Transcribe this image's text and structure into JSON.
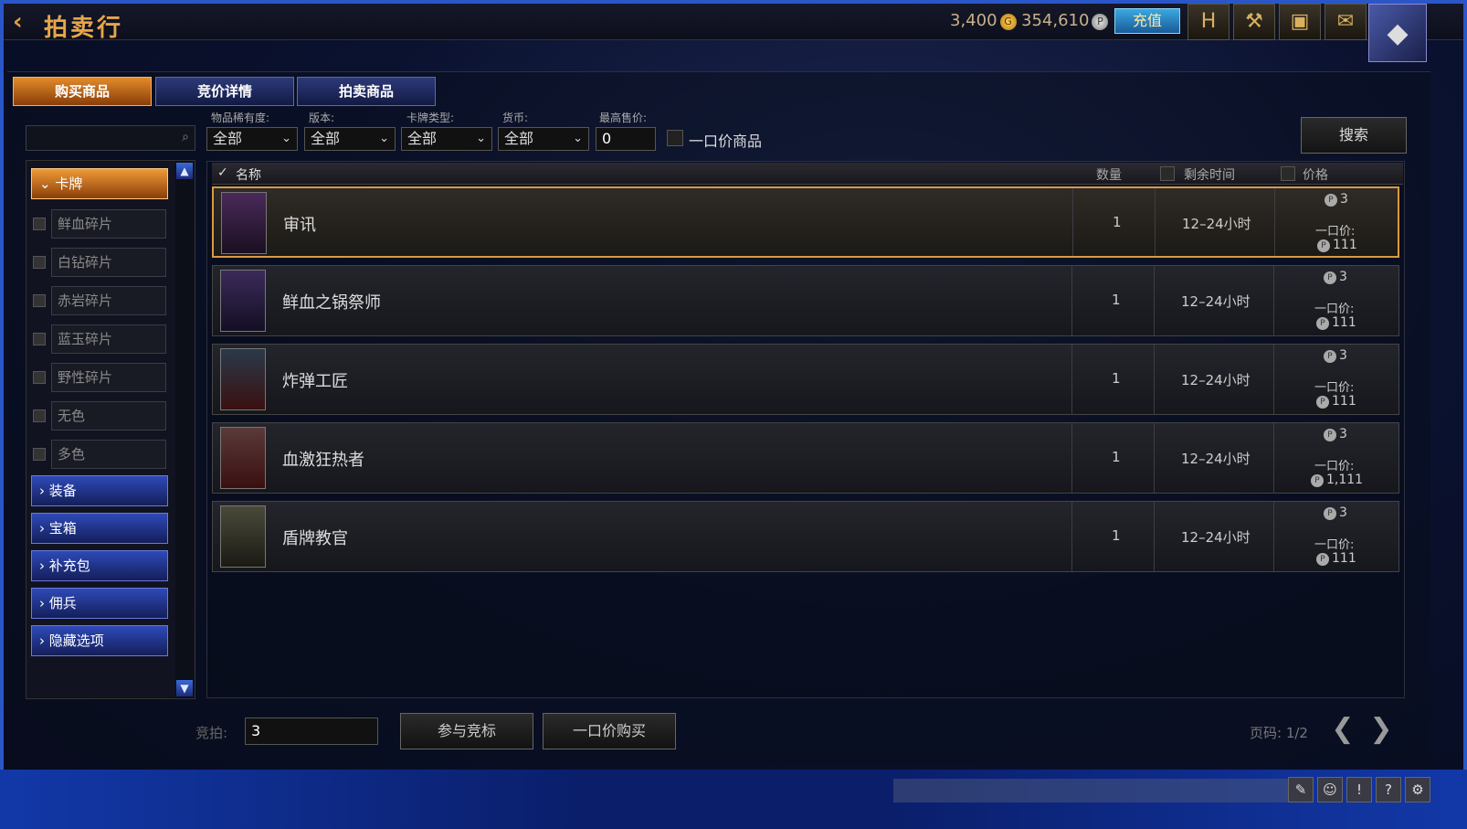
{
  "header": {
    "title": "拍卖行",
    "gold_amount": "3,400",
    "plat_amount": "354,610",
    "recharge_label": "充值",
    "icons": [
      "hero-icon",
      "hammer-icon",
      "chest-icon",
      "mail-icon",
      "avatar"
    ]
  },
  "tabs": [
    {
      "label": "购买商品",
      "active": true
    },
    {
      "label": "竞价详情",
      "active": false
    },
    {
      "label": "拍卖商品",
      "active": false
    }
  ],
  "filters": {
    "search_value": "",
    "rarity_label": "物品稀有度:",
    "rarity_value": "全部",
    "version_label": "版本:",
    "version_value": "全部",
    "card_type_label": "卡牌类型:",
    "card_type_value": "全部",
    "currency_label": "货币:",
    "currency_value": "全部",
    "max_price_label": "最高售价:",
    "max_price_value": "0",
    "buyout_only_label": "一口价商品",
    "search_button": "搜索"
  },
  "sidebar": {
    "categories": [
      {
        "label": "卡牌",
        "open": true
      },
      {
        "label": "装备",
        "open": false
      },
      {
        "label": "宝箱",
        "open": false
      },
      {
        "label": "补充包",
        "open": false
      },
      {
        "label": "佣兵",
        "open": false
      },
      {
        "label": "隐藏选项",
        "open": false
      }
    ],
    "shards": [
      "鲜血碎片",
      "白钻碎片",
      "赤岩碎片",
      "蓝玉碎片",
      "野性碎片",
      "无色",
      "多色"
    ]
  },
  "table": {
    "columns": {
      "name": "名称",
      "quantity": "数量",
      "time_left": "剩余时间",
      "price": "价格"
    },
    "buyout_label": "一口价:",
    "rows": [
      {
        "name": "审讯",
        "quantity": "1",
        "time": "12–24小时",
        "bid": "3",
        "buyout": "111",
        "selected": true
      },
      {
        "name": "鲜血之锅祭师",
        "quantity": "1",
        "time": "12–24小时",
        "bid": "3",
        "buyout": "111",
        "selected": false
      },
      {
        "name": "炸弹工匠",
        "quantity": "1",
        "time": "12–24小时",
        "bid": "3",
        "buyout": "111",
        "selected": false
      },
      {
        "name": "血激狂热者",
        "quantity": "1",
        "time": "12–24小时",
        "bid": "3",
        "buyout": "1,111",
        "selected": false
      },
      {
        "name": "盾牌教官",
        "quantity": "1",
        "time": "12–24小时",
        "bid": "3",
        "buyout": "111",
        "selected": false
      }
    ]
  },
  "footer": {
    "bid_label": "竞拍:",
    "bid_value": "3",
    "bid_button": "参与竞标",
    "buyout_button": "一口价购买",
    "page_label": "页码: 1/2"
  },
  "colors": {
    "accent_orange": "#e28a2a",
    "tab_blue": "#2c3a78",
    "frame_blue": "#2a56c8",
    "title_gold": "#e6a64a"
  }
}
